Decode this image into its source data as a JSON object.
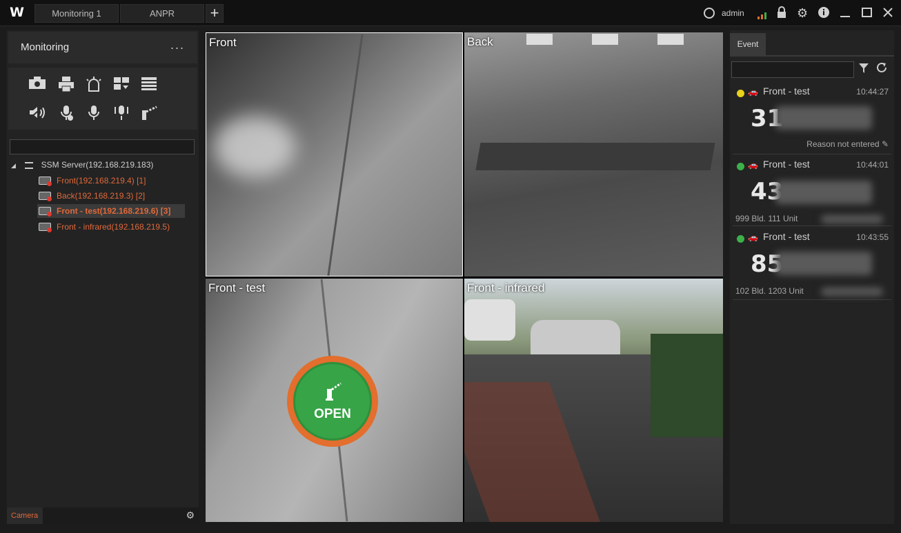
{
  "app": {
    "logo": "W"
  },
  "tabs": [
    {
      "label": "Monitoring 1"
    },
    {
      "label": "ANPR"
    }
  ],
  "topbar": {
    "user": "admin",
    "add_tab": "+"
  },
  "left_panel": {
    "title": "Monitoring",
    "more": "...",
    "server": "SSM Server(192.168.219.183)",
    "cameras": [
      {
        "label": "Front(192.168.219.4) [1]"
      },
      {
        "label": "Back(192.168.219.3) [2]"
      },
      {
        "label": "Front - test(192.168.219.6) [3]"
      },
      {
        "label": "Front - infrared(192.168.219.5)"
      }
    ],
    "footer_tab": "Camera"
  },
  "video": {
    "tiles": [
      {
        "label": "Front"
      },
      {
        "label": "Back"
      },
      {
        "label": "Front - test"
      },
      {
        "label": "Front - infrared"
      }
    ],
    "open_button": "OPEN"
  },
  "events": {
    "tab": "Event",
    "items": [
      {
        "status_color": "#e8d21a",
        "title": "Front - test",
        "time": "10:44:27",
        "plate": "31",
        "note": "Reason not entered",
        "unit": ""
      },
      {
        "status_color": "#3db04a",
        "title": "Front - test",
        "time": "10:44:01",
        "plate": "43",
        "note": "",
        "unit": "999 Bld. 111 Unit"
      },
      {
        "status_color": "#3db04a",
        "title": "Front - test",
        "time": "10:43:55",
        "plate": "85",
        "note": "",
        "unit": "102 Bld. 1203 Unit"
      }
    ]
  }
}
